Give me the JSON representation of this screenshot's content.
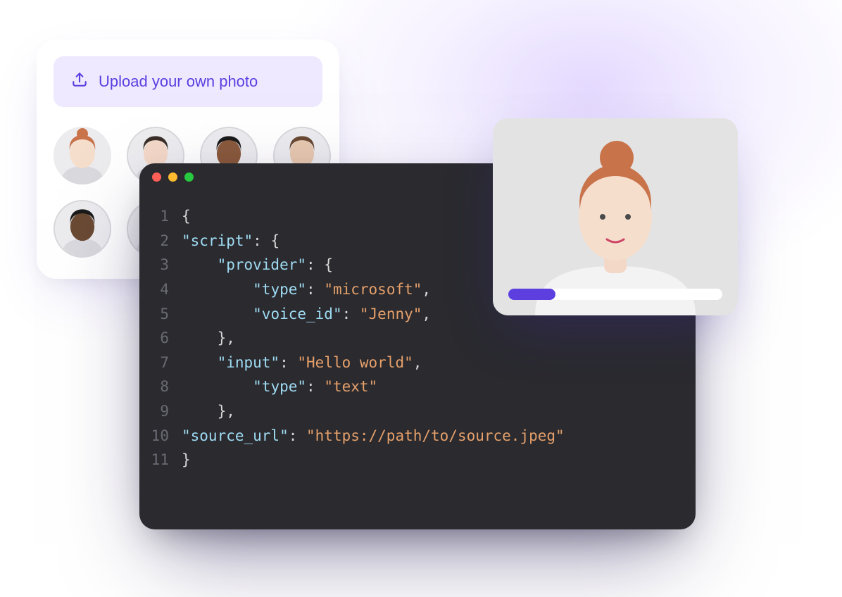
{
  "upload": {
    "label": "Upload your own photo",
    "icon": "upload-icon"
  },
  "avatars": [
    {
      "name": "avatar-1",
      "selected": true
    },
    {
      "name": "avatar-2",
      "selected": false
    },
    {
      "name": "avatar-3",
      "selected": false
    },
    {
      "name": "avatar-4",
      "selected": false
    },
    {
      "name": "avatar-5",
      "selected": false
    },
    {
      "name": "avatar-6",
      "selected": false
    },
    {
      "name": "avatar-7",
      "selected": false
    },
    {
      "name": "avatar-8",
      "selected": false
    }
  ],
  "code": {
    "window_controls": [
      "close",
      "minimize",
      "maximize"
    ],
    "lines": [
      {
        "n": 1,
        "tokens": [
          {
            "t": "{",
            "c": "brace"
          }
        ]
      },
      {
        "n": 2,
        "tokens": [
          {
            "t": "\"script\"",
            "c": "key"
          },
          {
            "t": ": {",
            "c": "punc"
          }
        ]
      },
      {
        "n": 3,
        "tokens": [
          {
            "t": "    ",
            "c": "punc"
          },
          {
            "t": "\"provider\"",
            "c": "key"
          },
          {
            "t": ": {",
            "c": "punc"
          }
        ]
      },
      {
        "n": 4,
        "tokens": [
          {
            "t": "        ",
            "c": "punc"
          },
          {
            "t": "\"type\"",
            "c": "key"
          },
          {
            "t": ": ",
            "c": "punc"
          },
          {
            "t": "\"microsoft\"",
            "c": "str"
          },
          {
            "t": ",",
            "c": "punc"
          }
        ]
      },
      {
        "n": 5,
        "tokens": [
          {
            "t": "        ",
            "c": "punc"
          },
          {
            "t": "\"voice_id\"",
            "c": "key"
          },
          {
            "t": ": ",
            "c": "punc"
          },
          {
            "t": "\"Jenny\"",
            "c": "str"
          },
          {
            "t": ",",
            "c": "punc"
          }
        ]
      },
      {
        "n": 6,
        "tokens": [
          {
            "t": "    },",
            "c": "punc"
          }
        ]
      },
      {
        "n": 7,
        "tokens": [
          {
            "t": "    ",
            "c": "punc"
          },
          {
            "t": "\"input\"",
            "c": "key"
          },
          {
            "t": ": ",
            "c": "punc"
          },
          {
            "t": "\"Hello world\"",
            "c": "str"
          },
          {
            "t": ",",
            "c": "punc"
          }
        ]
      },
      {
        "n": 8,
        "tokens": [
          {
            "t": "        ",
            "c": "punc"
          },
          {
            "t": "\"type\"",
            "c": "key"
          },
          {
            "t": ": ",
            "c": "punc"
          },
          {
            "t": "\"text\"",
            "c": "str"
          }
        ]
      },
      {
        "n": 9,
        "tokens": [
          {
            "t": "    },",
            "c": "punc"
          }
        ]
      },
      {
        "n": 10,
        "tokens": [
          {
            "t": "\"source_url\"",
            "c": "key"
          },
          {
            "t": ": ",
            "c": "punc"
          },
          {
            "t": "\"https://path/to/source.jpeg\"",
            "c": "str"
          }
        ]
      },
      {
        "n": 11,
        "tokens": [
          {
            "t": "}",
            "c": "brace"
          }
        ]
      }
    ]
  },
  "preview": {
    "progress_percent": 22
  },
  "colors": {
    "accent": "#5d3fe0",
    "accent_light": "#eee9ff",
    "editor_bg": "#2a2a2f"
  }
}
